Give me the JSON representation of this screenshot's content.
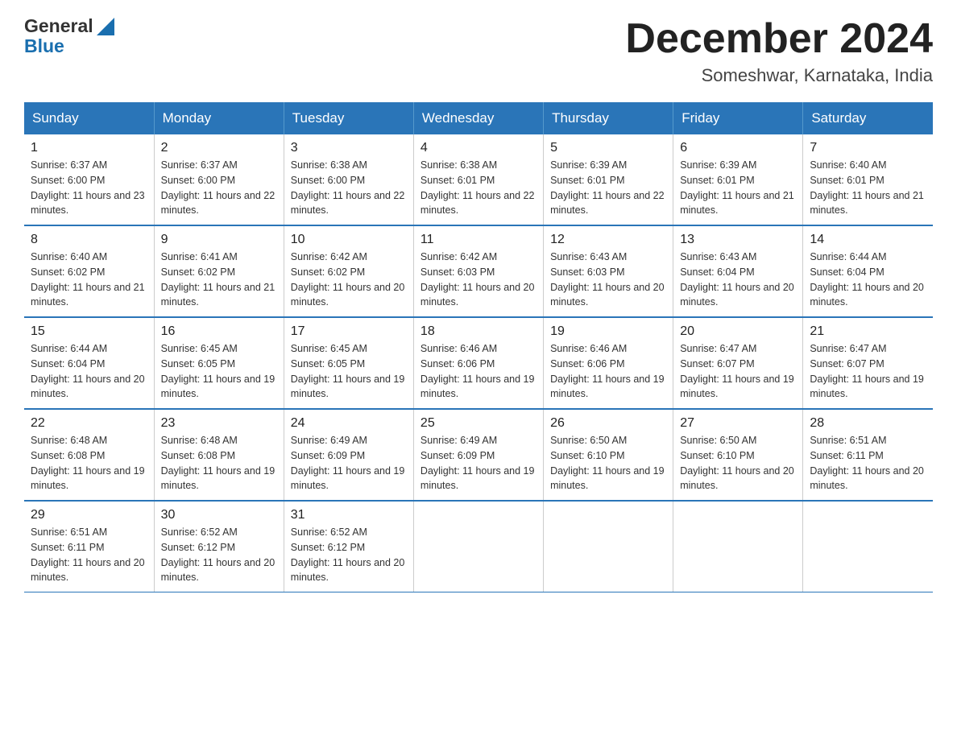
{
  "header": {
    "logo_line1": "General",
    "logo_line2": "Blue",
    "month_title": "December 2024",
    "location": "Someshwar, Karnataka, India"
  },
  "days_of_week": [
    "Sunday",
    "Monday",
    "Tuesday",
    "Wednesday",
    "Thursday",
    "Friday",
    "Saturday"
  ],
  "weeks": [
    [
      {
        "day": "1",
        "sunrise": "6:37 AM",
        "sunset": "6:00 PM",
        "daylight": "11 hours and 23 minutes."
      },
      {
        "day": "2",
        "sunrise": "6:37 AM",
        "sunset": "6:00 PM",
        "daylight": "11 hours and 22 minutes."
      },
      {
        "day": "3",
        "sunrise": "6:38 AM",
        "sunset": "6:00 PM",
        "daylight": "11 hours and 22 minutes."
      },
      {
        "day": "4",
        "sunrise": "6:38 AM",
        "sunset": "6:01 PM",
        "daylight": "11 hours and 22 minutes."
      },
      {
        "day": "5",
        "sunrise": "6:39 AM",
        "sunset": "6:01 PM",
        "daylight": "11 hours and 22 minutes."
      },
      {
        "day": "6",
        "sunrise": "6:39 AM",
        "sunset": "6:01 PM",
        "daylight": "11 hours and 21 minutes."
      },
      {
        "day": "7",
        "sunrise": "6:40 AM",
        "sunset": "6:01 PM",
        "daylight": "11 hours and 21 minutes."
      }
    ],
    [
      {
        "day": "8",
        "sunrise": "6:40 AM",
        "sunset": "6:02 PM",
        "daylight": "11 hours and 21 minutes."
      },
      {
        "day": "9",
        "sunrise": "6:41 AM",
        "sunset": "6:02 PM",
        "daylight": "11 hours and 21 minutes."
      },
      {
        "day": "10",
        "sunrise": "6:42 AM",
        "sunset": "6:02 PM",
        "daylight": "11 hours and 20 minutes."
      },
      {
        "day": "11",
        "sunrise": "6:42 AM",
        "sunset": "6:03 PM",
        "daylight": "11 hours and 20 minutes."
      },
      {
        "day": "12",
        "sunrise": "6:43 AM",
        "sunset": "6:03 PM",
        "daylight": "11 hours and 20 minutes."
      },
      {
        "day": "13",
        "sunrise": "6:43 AM",
        "sunset": "6:04 PM",
        "daylight": "11 hours and 20 minutes."
      },
      {
        "day": "14",
        "sunrise": "6:44 AM",
        "sunset": "6:04 PM",
        "daylight": "11 hours and 20 minutes."
      }
    ],
    [
      {
        "day": "15",
        "sunrise": "6:44 AM",
        "sunset": "6:04 PM",
        "daylight": "11 hours and 20 minutes."
      },
      {
        "day": "16",
        "sunrise": "6:45 AM",
        "sunset": "6:05 PM",
        "daylight": "11 hours and 19 minutes."
      },
      {
        "day": "17",
        "sunrise": "6:45 AM",
        "sunset": "6:05 PM",
        "daylight": "11 hours and 19 minutes."
      },
      {
        "day": "18",
        "sunrise": "6:46 AM",
        "sunset": "6:06 PM",
        "daylight": "11 hours and 19 minutes."
      },
      {
        "day": "19",
        "sunrise": "6:46 AM",
        "sunset": "6:06 PM",
        "daylight": "11 hours and 19 minutes."
      },
      {
        "day": "20",
        "sunrise": "6:47 AM",
        "sunset": "6:07 PM",
        "daylight": "11 hours and 19 minutes."
      },
      {
        "day": "21",
        "sunrise": "6:47 AM",
        "sunset": "6:07 PM",
        "daylight": "11 hours and 19 minutes."
      }
    ],
    [
      {
        "day": "22",
        "sunrise": "6:48 AM",
        "sunset": "6:08 PM",
        "daylight": "11 hours and 19 minutes."
      },
      {
        "day": "23",
        "sunrise": "6:48 AM",
        "sunset": "6:08 PM",
        "daylight": "11 hours and 19 minutes."
      },
      {
        "day": "24",
        "sunrise": "6:49 AM",
        "sunset": "6:09 PM",
        "daylight": "11 hours and 19 minutes."
      },
      {
        "day": "25",
        "sunrise": "6:49 AM",
        "sunset": "6:09 PM",
        "daylight": "11 hours and 19 minutes."
      },
      {
        "day": "26",
        "sunrise": "6:50 AM",
        "sunset": "6:10 PM",
        "daylight": "11 hours and 19 minutes."
      },
      {
        "day": "27",
        "sunrise": "6:50 AM",
        "sunset": "6:10 PM",
        "daylight": "11 hours and 20 minutes."
      },
      {
        "day": "28",
        "sunrise": "6:51 AM",
        "sunset": "6:11 PM",
        "daylight": "11 hours and 20 minutes."
      }
    ],
    [
      {
        "day": "29",
        "sunrise": "6:51 AM",
        "sunset": "6:11 PM",
        "daylight": "11 hours and 20 minutes."
      },
      {
        "day": "30",
        "sunrise": "6:52 AM",
        "sunset": "6:12 PM",
        "daylight": "11 hours and 20 minutes."
      },
      {
        "day": "31",
        "sunrise": "6:52 AM",
        "sunset": "6:12 PM",
        "daylight": "11 hours and 20 minutes."
      },
      null,
      null,
      null,
      null
    ]
  ]
}
